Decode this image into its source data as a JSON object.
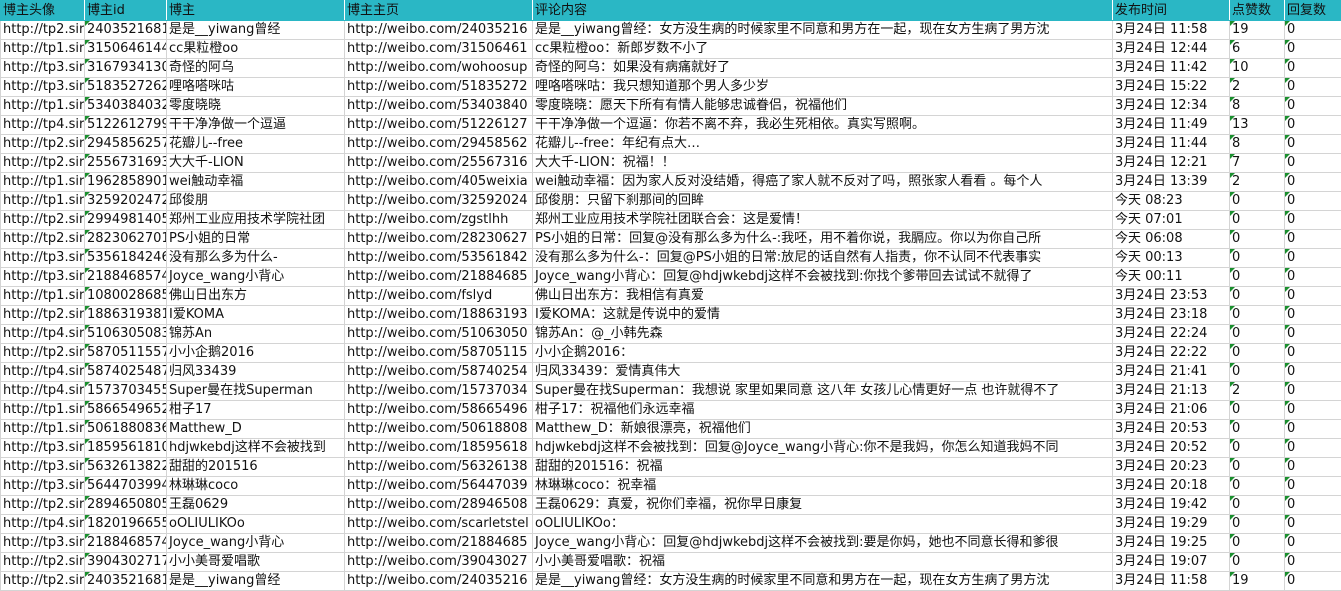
{
  "headers": [
    "博主头像",
    "博主id",
    "博主",
    "博主主页",
    "评论内容",
    "发布时间",
    "点赞数",
    "回复数"
  ],
  "rows": [
    [
      "http://tp2.sir",
      "2403521681",
      "是是__yiwang曾经",
      "http://weibo.com/24035216",
      "是是__yiwang曾经：女方没生病的时候家里不同意和男方在一起，现在女方生病了男方沈",
      "3月24日 11:58",
      "19",
      "0"
    ],
    [
      "http://tp1.sir",
      "3150646144",
      "cc果粒橙oo",
      "http://weibo.com/31506461",
      "cc果粒橙oo：新郎岁数不小了",
      "3月24日 12:44",
      "6",
      "0"
    ],
    [
      "http://tp3.sir",
      "3167934130",
      "奇怪的阿乌",
      "http://weibo.com/wohoosup",
      "奇怪的阿乌：如果没有病痛就好了",
      "3月24日 11:42",
      "10",
      "0"
    ],
    [
      "http://tp3.sir",
      "5183527262",
      "哩咯嗒咪咕",
      "http://weibo.com/51835272",
      "哩咯嗒咪咕：我只想知道那个男人多少岁",
      "3月24日 15:22",
      "2",
      "0"
    ],
    [
      "http://tp1.sir",
      "5340384032",
      "零度晓晓",
      "http://weibo.com/53403840",
      "零度晓晓：愿天下所有有情人能够忠诚眷侣，祝福他们",
      "3月24日 12:34",
      "8",
      "0"
    ],
    [
      "http://tp4.sir",
      "5122612799",
      "干干净净做一个逗逼",
      "http://weibo.com/51226127",
      "干干净净做一个逗逼：你若不离不弃，我必生死相依。真实写照啊。",
      "3月24日 11:49",
      "13",
      "0"
    ],
    [
      "http://tp2.sir",
      "2945856257",
      "花瓣儿--free",
      "http://weibo.com/29458562",
      "花瓣儿--free：年纪有点大…",
      "3月24日 11:44",
      "8",
      "0"
    ],
    [
      "http://tp2.sir",
      "2556731693",
      "大大千-LION",
      "http://weibo.com/25567316",
      "大大千-LION：祝福！！",
      "3月24日 12:21",
      "7",
      "0"
    ],
    [
      "http://tp1.sir",
      "1962858901",
      "wei触动幸福",
      "http://weibo.com/405weixia",
      "wei触动幸福：因为家人反对没结婚，得癌了家人就不反对了吗，照张家人看看 。每个人",
      "3月24日 13:39",
      "2",
      "0"
    ],
    [
      "http://tp1.sir",
      "3259202472",
      "邱俊朋",
      "http://weibo.com/32592024",
      "邱俊朋：只留下刹那间的回眸",
      "今天 08:23",
      "0",
      "0"
    ],
    [
      "http://tp2.sir",
      "2994981405",
      "郑州工业应用技术学院社团",
      "http://weibo.com/zgstlhh",
      "郑州工业应用技术学院社团联合会：这是爱情！",
      "今天 07:01",
      "0",
      "0"
    ],
    [
      "http://tp2.sir",
      "2823062701",
      "PS小姐的日常",
      "http://weibo.com/28230627",
      "PS小姐的日常：回复@没有那么多为什么-:我呸，用不着你说，我膈应。你以为你自己所",
      "今天 06:08",
      "0",
      "0"
    ],
    [
      "http://tp3.sir",
      "5356184246",
      "没有那么多为什么-",
      "http://weibo.com/53561842",
      "没有那么多为什么-：回复@PS小姐的日常:放尼的话自然有人指责，你不认同不代表事实",
      "今天 00:13",
      "0",
      "0"
    ],
    [
      "http://tp3.sir",
      "2188468574",
      "Joyce_wang小背心",
      "http://weibo.com/21884685",
      "Joyce_wang小背心：回复@hdjwkebdj这样不会被找到:你找个爹带回去试试不就得了",
      "今天 00:11",
      "0",
      "0"
    ],
    [
      "http://tp1.sir",
      "1080028685",
      "佛山日出东方",
      "http://weibo.com/fslyd",
      "佛山日出东方：我相信有真爱",
      "3月24日 23:53",
      "0",
      "0"
    ],
    [
      "http://tp2.sir",
      "1886319381",
      "I爱KOMA",
      "http://weibo.com/18863193",
      "I爱KOMA：这就是传说中的爱情",
      "3月24日 23:18",
      "0",
      "0"
    ],
    [
      "http://tp4.sir",
      "5106305083",
      "锦苏An",
      "http://weibo.com/51063050",
      "锦苏An：@_小韩先森",
      "3月24日 22:24",
      "0",
      "0"
    ],
    [
      "http://tp2.sir",
      "5870511557",
      "小小企鹅2016",
      "http://weibo.com/58705115",
      "小小企鹅2016：",
      "3月24日 22:22",
      "0",
      "0"
    ],
    [
      "http://tp4.sir",
      "5874025487",
      "归风33439",
      "http://weibo.com/58740254",
      "归风33439：爱情真伟大",
      "3月24日 21:41",
      "0",
      "0"
    ],
    [
      "http://tp4.sir",
      "1573703455",
      "Super曼在找Superman",
      "http://weibo.com/15737034",
      "Super曼在找Superman：我想说 家里如果同意 这八年 女孩儿心情更好一点 也许就得不了",
      "3月24日 21:13",
      "2",
      "0"
    ],
    [
      "http://tp1.sir",
      "5866549652",
      "柑子17",
      "http://weibo.com/58665496",
      "柑子17：祝福他们永远幸福",
      "3月24日 21:06",
      "0",
      "0"
    ],
    [
      "http://tp1.sir",
      "5061880836",
      "Matthew_D",
      "http://weibo.com/50618808",
      "Matthew_D：新娘很漂亮，祝福他们",
      "3月24日 20:53",
      "0",
      "0"
    ],
    [
      "http://tp3.sir",
      "1859561810",
      "hdjwkebdj这样不会被找到",
      "http://weibo.com/18595618",
      "hdjwkebdj这样不会被找到：回复@Joyce_wang小背心:你不是我妈，你怎么知道我妈不同",
      "3月24日 20:52",
      "0",
      "0"
    ],
    [
      "http://tp3.sir",
      "5632613822",
      "甜甜的201516",
      "http://weibo.com/56326138",
      "甜甜的201516：祝福",
      "3月24日 20:23",
      "0",
      "0"
    ],
    [
      "http://tp3.sir",
      "5644703994",
      "林琳琳coco",
      "http://weibo.com/56447039",
      "林琳琳coco：祝幸福",
      "3月24日 20:18",
      "0",
      "0"
    ],
    [
      "http://tp2.sir",
      "2894650805",
      "王磊0629",
      "http://weibo.com/28946508",
      "王磊0629：真爱，祝你们幸福，祝你早日康复",
      "3月24日 19:42",
      "0",
      "0"
    ],
    [
      "http://tp4.sir",
      "1820196655",
      "oOLIULIKOo",
      "http://weibo.com/scarletstel",
      "oOLIULIKOo：",
      "3月24日 19:29",
      "0",
      "0"
    ],
    [
      "http://tp3.sir",
      "2188468574",
      "Joyce_wang小背心",
      "http://weibo.com/21884685",
      "Joyce_wang小背心：回复@hdjwkebdj这样不会被找到:要是你妈，她也不同意长得和爹很",
      "3月24日 19:25",
      "0",
      "0"
    ],
    [
      "http://tp2.sir",
      "3904302717",
      "小小美哥爱唱歌",
      "http://weibo.com/39043027",
      "小小美哥爱唱歌：祝福",
      "3月24日 19:07",
      "0",
      "0"
    ],
    [
      "http://tp2.sir",
      "2403521681",
      "是是__yiwang曾经",
      "http://weibo.com/24035216",
      "是是__yiwang曾经：女方没生病的时候家里不同意和男方在一起，现在女方生病了男方沈",
      "3月24日 11:58",
      "19",
      "0"
    ]
  ]
}
